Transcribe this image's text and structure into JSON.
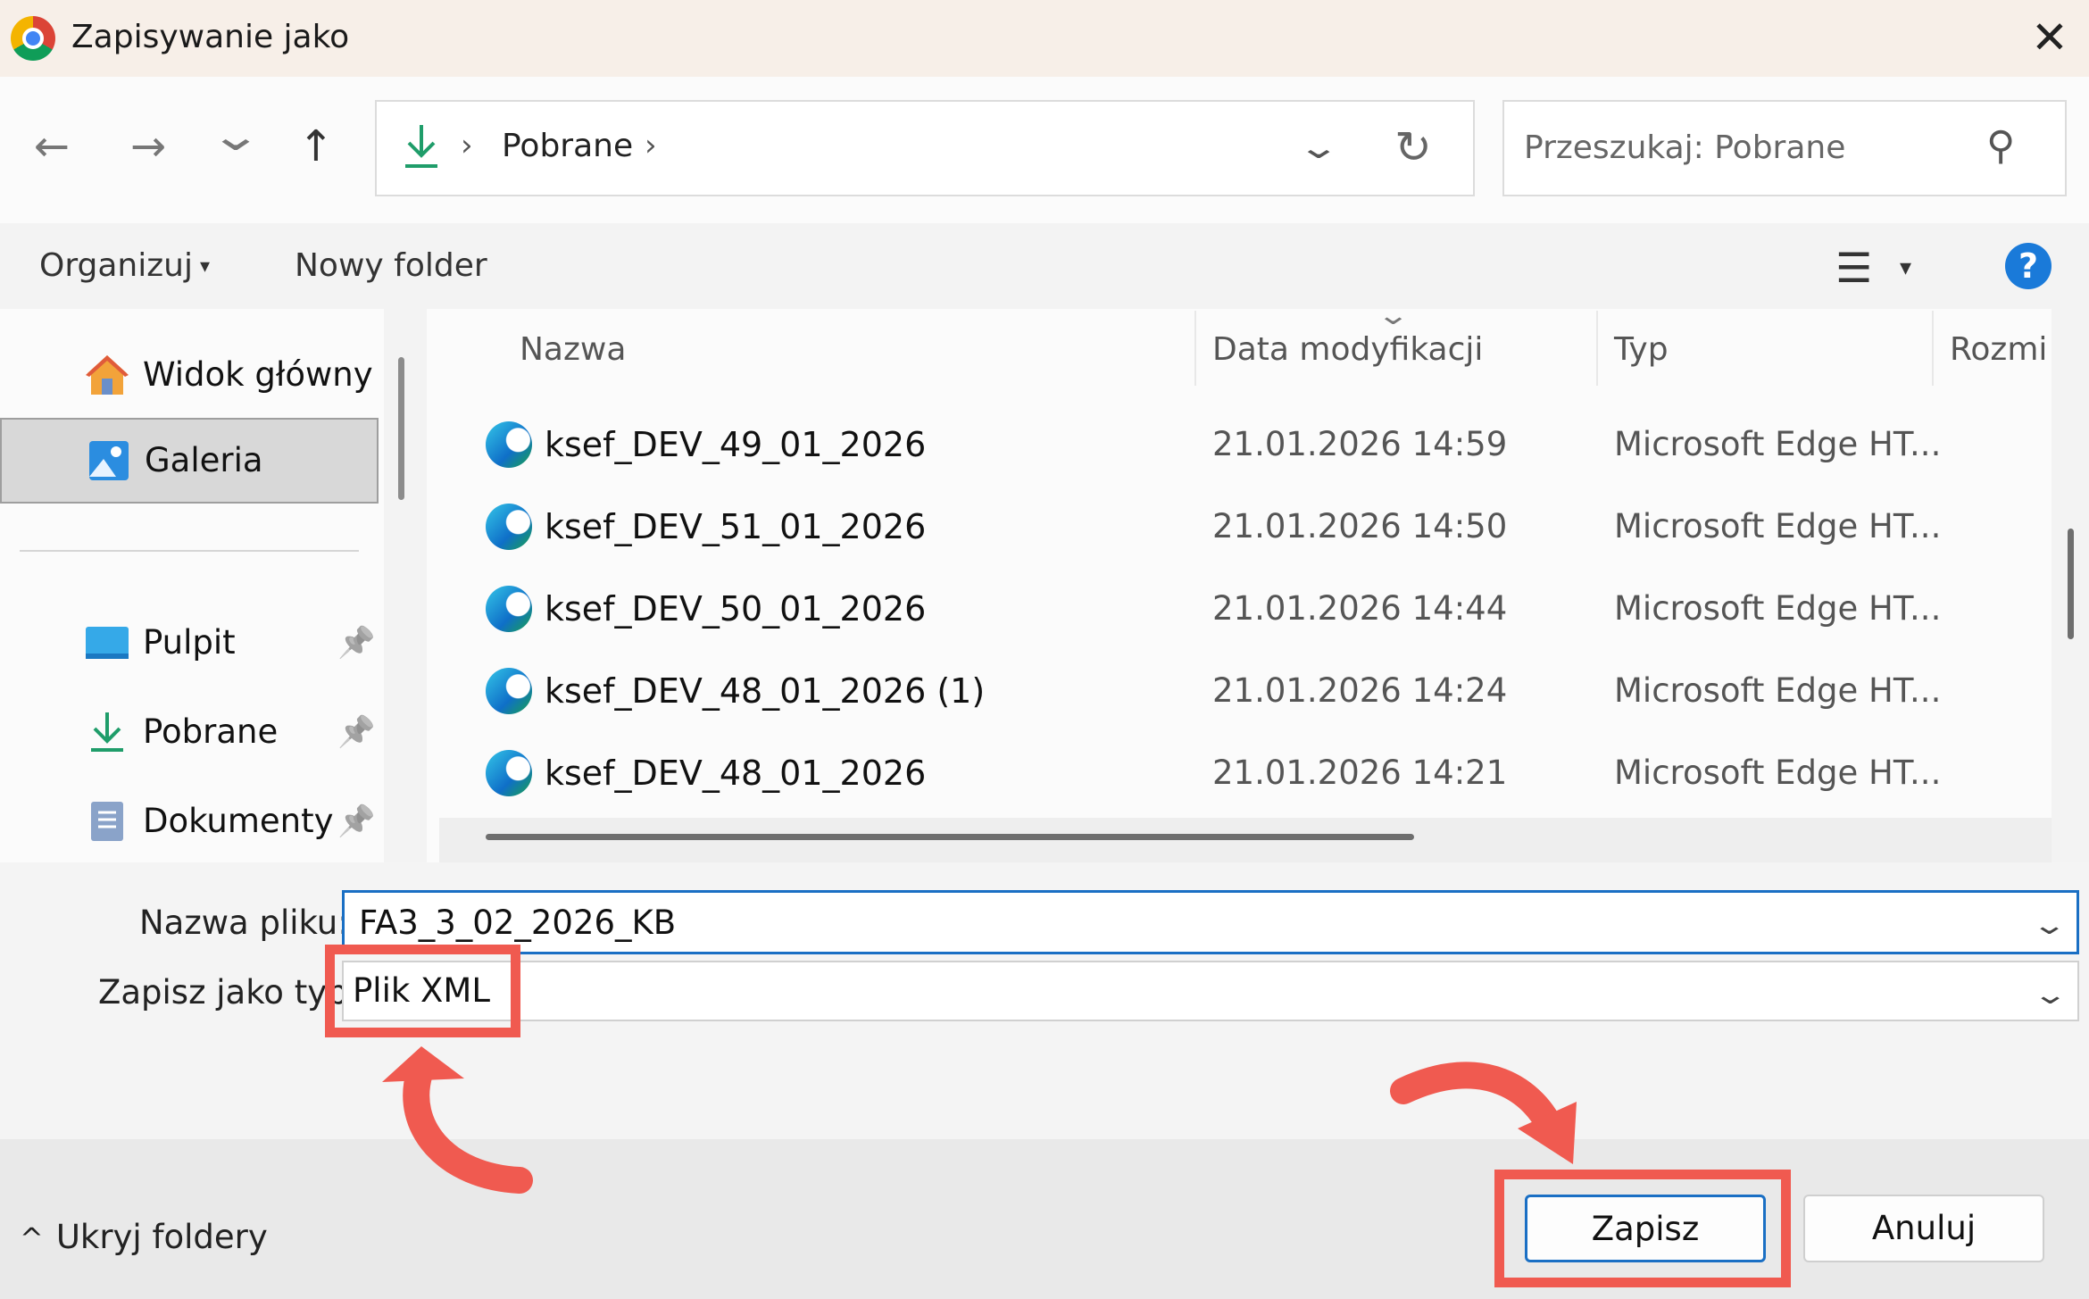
{
  "window": {
    "title": "Zapisywanie jako",
    "close_glyph": "✕"
  },
  "nav": {
    "back_glyph": "←",
    "forward_glyph": "→",
    "recent_glyph": "⌄",
    "up_glyph": "↑",
    "address_sep": "›",
    "address_location": "Pobrane",
    "address_dropdown_glyph": "⌄",
    "refresh_glyph": "↻",
    "search_placeholder": "Przeszukaj: Pobrane",
    "search_glyph": "⚲"
  },
  "toolbar": {
    "organize_label": "Organizuj",
    "organize_caret": "▾",
    "new_folder_label": "Nowy folder",
    "view_glyph": "☰",
    "view_caret": "▾",
    "help_glyph": "?"
  },
  "sidebar": {
    "items": [
      {
        "label": "Widok główny",
        "icon": "home-icon"
      },
      {
        "label": "Galeria",
        "icon": "gallery-icon",
        "selected": true
      },
      {
        "label": "Pulpit",
        "icon": "desktop-icon",
        "pinned": true
      },
      {
        "label": "Pobrane",
        "icon": "download-icon",
        "pinned": true
      },
      {
        "label": "Dokumenty",
        "icon": "documents-icon",
        "pinned": true
      }
    ],
    "pin_glyph": "📌"
  },
  "file_list": {
    "columns": [
      "Nazwa",
      "Data modyfikacji",
      "Typ",
      "Rozmi"
    ],
    "sort_glyph": "⌄",
    "rows": [
      {
        "name": "ksef_DEV_49_01_2026",
        "date": "21.01.2026 14:59",
        "type": "Microsoft Edge HT..."
      },
      {
        "name": "ksef_DEV_51_01_2026",
        "date": "21.01.2026 14:50",
        "type": "Microsoft Edge HT..."
      },
      {
        "name": "ksef_DEV_50_01_2026",
        "date": "21.01.2026 14:44",
        "type": "Microsoft Edge HT..."
      },
      {
        "name": "ksef_DEV_48_01_2026 (1)",
        "date": "21.01.2026 14:24",
        "type": "Microsoft Edge HT..."
      },
      {
        "name": "ksef_DEV_48_01_2026",
        "date": "21.01.2026 14:21",
        "type": "Microsoft Edge HT..."
      }
    ]
  },
  "form": {
    "filename_label": "Nazwa pliku:",
    "filename_value": "FA3_3_02_2026_KB",
    "type_label": "Zapisz jako typ:",
    "type_value": "Plik XML",
    "dropdown_glyph": "⌄"
  },
  "footer": {
    "hide_folders_glyph": "^",
    "hide_folders_label": "Ukryj foldery",
    "save_label": "Zapisz",
    "cancel_label": "Anuluj"
  },
  "annotations": {
    "highlight_color": "#f05a50"
  }
}
